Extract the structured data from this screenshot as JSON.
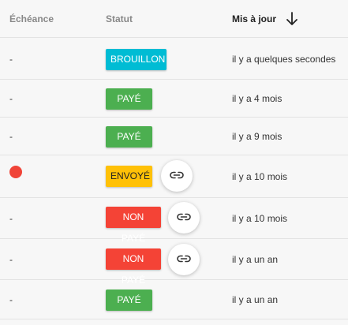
{
  "columns": {
    "due": "Échéance",
    "status": "Statut",
    "updated": "Mis à jour"
  },
  "colors": {
    "draft": "#00bcd4",
    "paid": "#4caf50",
    "sent": "#ffc107",
    "unpaid": "#f44336",
    "overdue_dot": "#f04438"
  },
  "rows": [
    {
      "due": "-",
      "status": "BROUILLON",
      "updated": "il y a quelques secondes"
    },
    {
      "due": "-",
      "status": "PAYÉ",
      "updated": "il y a 4 mois"
    },
    {
      "due": "-",
      "status": "PAYÉ",
      "updated": "il y a 9 mois"
    },
    {
      "due_indicator": "overdue-dot",
      "status": "ENVOYÉ",
      "link_icon": "link-icon",
      "updated": "il y a 10 mois"
    },
    {
      "due": "-",
      "status": "NON PAYÉ",
      "link_icon": "link-icon",
      "updated": "il y a 10 mois"
    },
    {
      "due": "-",
      "status": "NON PAYÉ",
      "link_icon": "link-icon",
      "updated": "il y a un an"
    },
    {
      "due": "-",
      "status": "PAYÉ",
      "updated": "il y a un an"
    }
  ]
}
